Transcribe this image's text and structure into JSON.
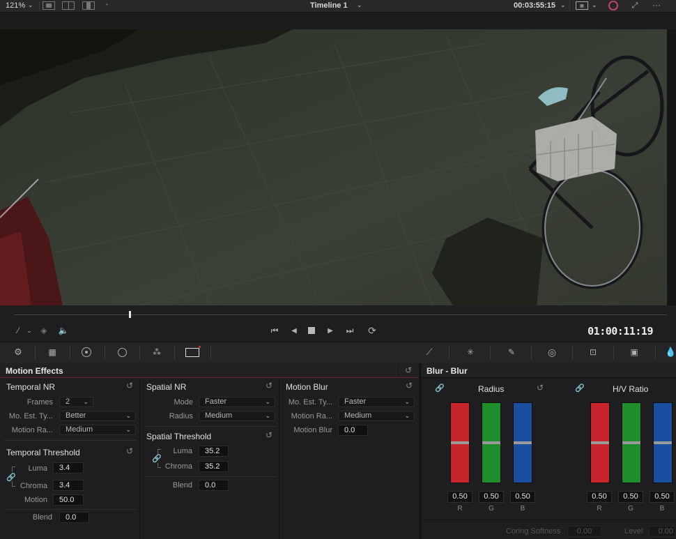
{
  "topbar": {
    "zoom": "121%",
    "timeline_name": "Timeline 1",
    "duration": "00:03:55:15"
  },
  "transport": {
    "timecode": "01:00:11:19"
  },
  "motion_effects": {
    "title": "Motion Effects",
    "temporal_nr": {
      "title": "Temporal NR",
      "frames_label": "Frames",
      "frames_value": "2",
      "mo_est_label": "Mo. Est. Ty...",
      "mo_est_value": "Better",
      "motion_range_label": "Motion Ra...",
      "motion_range_value": "Medium"
    },
    "temporal_threshold": {
      "title": "Temporal Threshold",
      "luma_label": "Luma",
      "luma_value": "3.4",
      "chroma_label": "Chroma",
      "chroma_value": "3.4",
      "motion_label": "Motion",
      "motion_value": "50.0",
      "blend_label": "Blend",
      "blend_value": "0.0"
    },
    "spatial_nr": {
      "title": "Spatial NR",
      "mode_label": "Mode",
      "mode_value": "Faster",
      "radius_label": "Radius",
      "radius_value": "Medium"
    },
    "spatial_threshold": {
      "title": "Spatial Threshold",
      "luma_label": "Luma",
      "luma_value": "35.2",
      "chroma_label": "Chroma",
      "chroma_value": "35.2",
      "blend_label": "Blend",
      "blend_value": "0.0"
    },
    "motion_blur": {
      "title": "Motion Blur",
      "mo_est_label": "Mo. Est. Ty...",
      "mo_est_value": "Faster",
      "motion_range_label": "Motion Ra...",
      "motion_range_value": "Medium",
      "motion_blur_label": "Motion Blur",
      "motion_blur_value": "0.0"
    }
  },
  "blur": {
    "title": "Blur - Blur",
    "radius": {
      "title": "Radius",
      "r": "0.50",
      "g": "0.50",
      "b": "0.50",
      "level": 0.5
    },
    "hv_ratio": {
      "title": "H/V Ratio",
      "r": "0.50",
      "g": "0.50",
      "b": "0.50",
      "level": 0.5
    },
    "channel_labels": {
      "r": "R",
      "g": "G",
      "b": "B"
    },
    "coring_softness_label": "Coring Softness",
    "coring_softness_value": "0.00",
    "level_label": "Level",
    "level_value": "0.00"
  },
  "colors": {
    "red_bar": "#c8242b",
    "green_bar": "#1f8e2c",
    "blue_bar": "#1a4fa0",
    "header_accent": "#6b2a2a"
  },
  "icons": {
    "view_modes": [
      "single-viewer-icon",
      "split-viewer-icon",
      "compare-viewer-icon"
    ],
    "transport": [
      "jump-start-icon",
      "play-reverse-icon",
      "stop-icon",
      "play-icon",
      "jump-end-icon",
      "loop-icon"
    ],
    "palette_left": [
      "camera-raw-icon",
      "color-match-icon",
      "color-wheels-icon",
      "hdr-wheels-icon",
      "rgb-mixer-icon",
      "motion-effects-icon"
    ],
    "palette_right": [
      "curves-icon",
      "color-warper-icon",
      "qualifier-icon",
      "window-icon",
      "tracker-icon",
      "blur-icon",
      "key-icon"
    ]
  }
}
